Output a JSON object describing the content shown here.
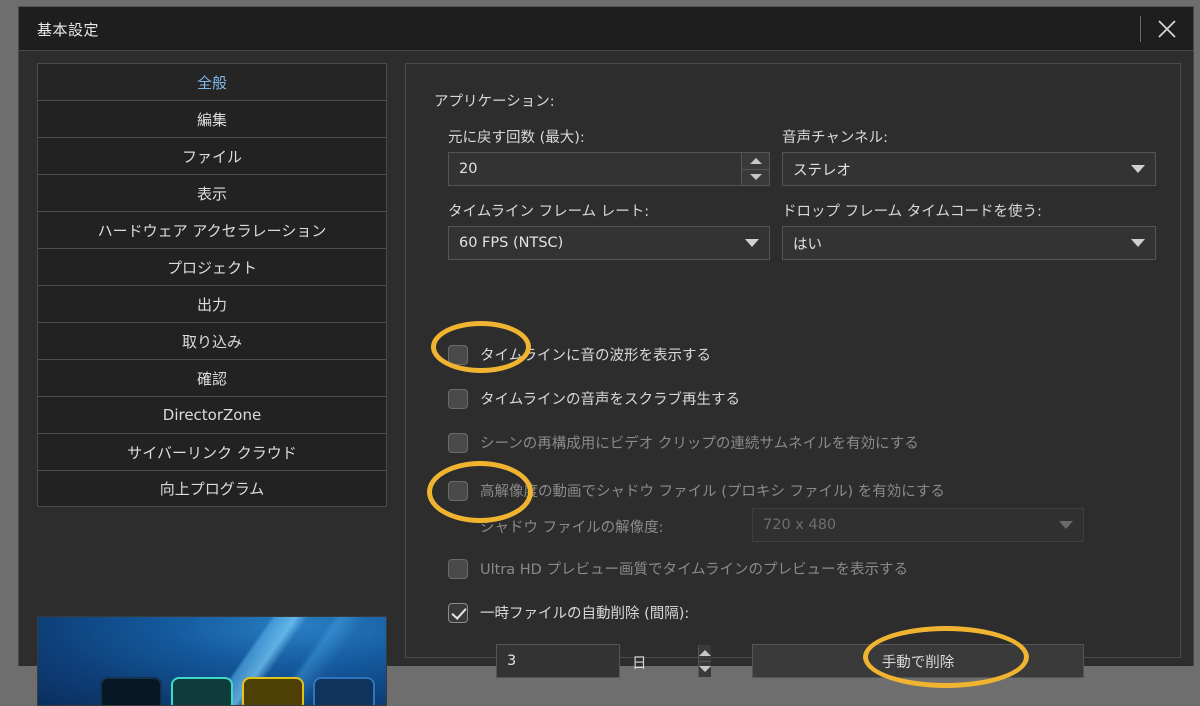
{
  "window": {
    "title": "基本設定",
    "close_icon": "close-icon"
  },
  "sidebar": {
    "items": [
      {
        "label": "全般",
        "active": true
      },
      {
        "label": "編集",
        "active": false
      },
      {
        "label": "ファイル",
        "active": false
      },
      {
        "label": "表示",
        "active": false
      },
      {
        "label": "ハードウェア アクセラレーション",
        "active": false
      },
      {
        "label": "プロジェクト",
        "active": false
      },
      {
        "label": "出力",
        "active": false
      },
      {
        "label": "取り込み",
        "active": false
      },
      {
        "label": "確認",
        "active": false
      },
      {
        "label": "DirectorZone",
        "active": false
      },
      {
        "label": "サイバーリンク クラウド",
        "active": false
      },
      {
        "label": "向上プログラム",
        "active": false
      }
    ],
    "preview_alt": "preview-thumbnail"
  },
  "main": {
    "section_label": "アプリケーション:",
    "undo": {
      "label": "元に戻す回数 (最大):",
      "value": "20"
    },
    "audio_channel": {
      "label": "音声チャンネル:",
      "value": "ステレオ"
    },
    "frame_rate": {
      "label": "タイムライン フレーム レート:",
      "value": "60 FPS (NTSC)"
    },
    "drop_frame": {
      "label": "ドロップ フレーム タイムコードを使う:",
      "value": "はい"
    },
    "checkboxes": [
      {
        "label": "タイムラインに音の波形を表示する",
        "checked": false,
        "disabled": false
      },
      {
        "label": "タイムラインの音声をスクラブ再生する",
        "checked": false,
        "disabled": false
      },
      {
        "label": "シーンの再構成用にビデオ クリップの連続サムネイルを有効にする",
        "checked": false,
        "disabled": true
      },
      {
        "label": "高解像度の動画でシャドウ ファイル (プロキシ ファイル) を有効にする",
        "checked": false,
        "disabled": true
      },
      {
        "label": "Ultra HD プレビュー画質でタイムラインのプレビューを表示する",
        "checked": false,
        "disabled": true
      },
      {
        "label": "一時ファイルの自動削除 (間隔):",
        "checked": true,
        "disabled": false
      }
    ],
    "shadow_resolution": {
      "label": "シャドウ ファイルの解像度:",
      "value": "720 x 480"
    },
    "temp_interval": {
      "value": "3",
      "unit": "日"
    },
    "manual_delete_button": "手動で削除"
  },
  "annotations": {
    "color": "#f0b431",
    "targets": [
      "waveform-checkbox",
      "shadow-file-checkbox",
      "manual-delete-button"
    ]
  }
}
